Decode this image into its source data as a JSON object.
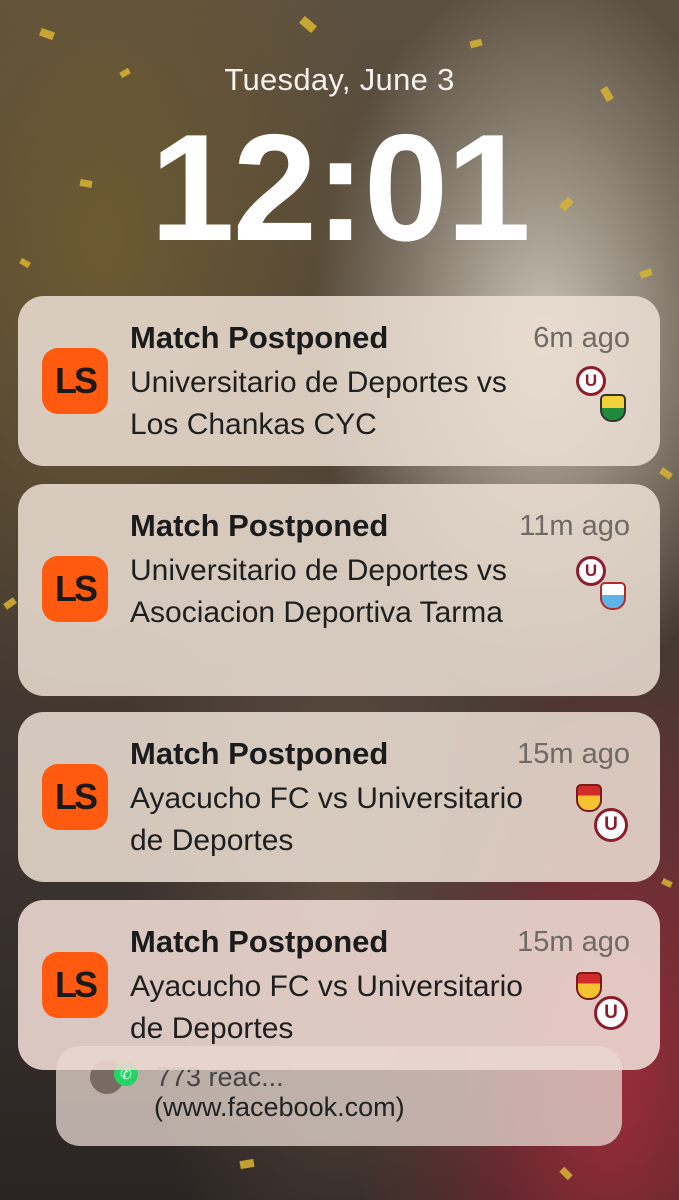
{
  "lockscreen": {
    "date": "Tuesday, June 3",
    "time": "12:01"
  },
  "notifications": [
    {
      "app_icon_text": "LS",
      "title": "Match Postponed",
      "time_ago": "6m ago",
      "body": "Universitario de Deportes vs Los Chankas CYC",
      "team_logos": [
        "universitario-crest-icon",
        "los-chankas-crest-icon"
      ]
    },
    {
      "app_icon_text": "LS",
      "title": "Match Postponed",
      "time_ago": "11m ago",
      "body": "Universitario de Deportes vs Asociacion Deportiva Tarma",
      "team_logos": [
        "universitario-crest-icon",
        "adt-crest-icon"
      ]
    },
    {
      "app_icon_text": "LS",
      "title": "Match Postponed",
      "time_ago": "15m ago",
      "body": "Ayacucho FC vs Universitario de Deportes",
      "team_logos": [
        "ayacucho-crest-icon",
        "universitario-crest-icon"
      ]
    },
    {
      "app_icon_text": "LS",
      "title": "Match Postponed",
      "time_ago": "15m ago",
      "body": "Ayacucho FC vs Universitario de Deportes",
      "team_logos": [
        "ayacucho-crest-icon",
        "universitario-crest-icon"
      ]
    }
  ],
  "stacked_notification": {
    "line1": "773 reac...",
    "line2": "(www.facebook.com)",
    "icon": "whatsapp-icon"
  },
  "colors": {
    "app_accent": "#ff5a0f",
    "universitario_red": "#8c1d2c"
  }
}
